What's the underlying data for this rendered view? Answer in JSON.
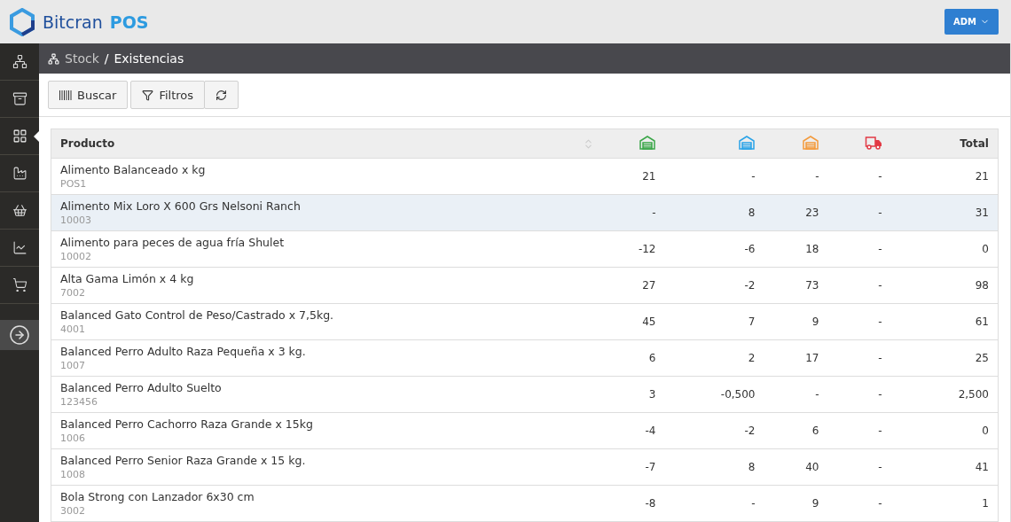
{
  "brand": {
    "name": "Bitcran",
    "suffix": "POS"
  },
  "user_menu": {
    "label": "ADM"
  },
  "sidebar": {
    "items": [
      {
        "selected": false
      },
      {
        "selected": false
      },
      {
        "selected": true
      },
      {
        "selected": false
      },
      {
        "selected": false
      },
      {
        "selected": false
      },
      {
        "selected": false
      }
    ]
  },
  "breadcrumb": {
    "parent": "Stock",
    "separator": "/",
    "current": "Existencias"
  },
  "toolbar": {
    "search_button": "Buscar",
    "filter_button": "Filtros"
  },
  "table": {
    "columns": [
      {
        "kind": "text",
        "label": "Producto"
      },
      {
        "kind": "warehouse",
        "color": "#3aa648"
      },
      {
        "kind": "warehouse",
        "color": "#29a3e8"
      },
      {
        "kind": "warehouse",
        "color": "#f39a3c"
      },
      {
        "kind": "truck",
        "color": "#e23a45"
      },
      {
        "kind": "text",
        "label": "Total"
      }
    ],
    "rows": [
      {
        "name": "Alimento Balanceado x kg",
        "code": "POS1",
        "values": [
          "21",
          "-",
          "-",
          "-",
          "21"
        ],
        "selected": false
      },
      {
        "name": "Alimento Mix Loro X 600 Grs Nelsoni Ranch",
        "code": "10003",
        "values": [
          "-",
          "8",
          "23",
          "-",
          "31"
        ],
        "selected": true
      },
      {
        "name": "Alimento para peces de agua fría Shulet",
        "code": "10002",
        "values": [
          "-12",
          "-6",
          "18",
          "-",
          "0"
        ],
        "selected": false
      },
      {
        "name": "Alta Gama Limón x 4 kg",
        "code": "7002",
        "values": [
          "27",
          "-2",
          "73",
          "-",
          "98"
        ],
        "selected": false
      },
      {
        "name": "Balanced Gato Control de Peso/Castrado x 7,5kg.",
        "code": "4001",
        "values": [
          "45",
          "7",
          "9",
          "-",
          "61"
        ],
        "selected": false
      },
      {
        "name": "Balanced Perro Adulto Raza Pequeña x 3 kg.",
        "code": "1007",
        "values": [
          "6",
          "2",
          "17",
          "-",
          "25"
        ],
        "selected": false
      },
      {
        "name": "Balanced Perro Adulto Suelto",
        "code": "123456",
        "values": [
          "3",
          "-0,500",
          "-",
          "-",
          "2,500"
        ],
        "selected": false
      },
      {
        "name": "Balanced Perro Cachorro Raza Grande x 15kg",
        "code": "1006",
        "values": [
          "-4",
          "-2",
          "6",
          "-",
          "0"
        ],
        "selected": false
      },
      {
        "name": "Balanced Perro Senior Raza Grande x 15 kg.",
        "code": "1008",
        "values": [
          "-7",
          "8",
          "40",
          "-",
          "41"
        ],
        "selected": false
      },
      {
        "name": "Bola Strong con Lanzador 6x30 cm",
        "code": "3002",
        "values": [
          "-8",
          "-",
          "9",
          "-",
          "1"
        ],
        "selected": false
      }
    ]
  }
}
